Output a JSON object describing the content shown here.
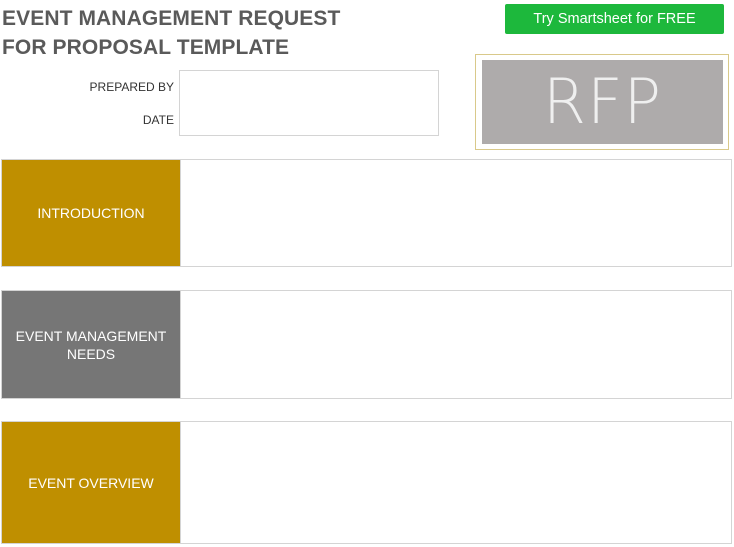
{
  "header": {
    "title_line1": "EVENT MANAGEMENT REQUEST",
    "title_line2": "FOR PROPOSAL TEMPLATE",
    "cta_label": "Try Smartsheet for FREE",
    "cta_color": "#1db83c"
  },
  "meta": {
    "prepared_by_label": "PREPARED BY",
    "prepared_by_value": "",
    "date_label": "DATE",
    "date_value": ""
  },
  "logo": {
    "text": "RFP",
    "background": "#aeabab"
  },
  "sections": [
    {
      "label": "INTRODUCTION",
      "color": "#bf8f00",
      "content": ""
    },
    {
      "label": "EVENT MANAGEMENT NEEDS",
      "color": "#767676",
      "content": ""
    },
    {
      "label": "EVENT OVERVIEW",
      "color": "#bf8f00",
      "content": ""
    }
  ]
}
